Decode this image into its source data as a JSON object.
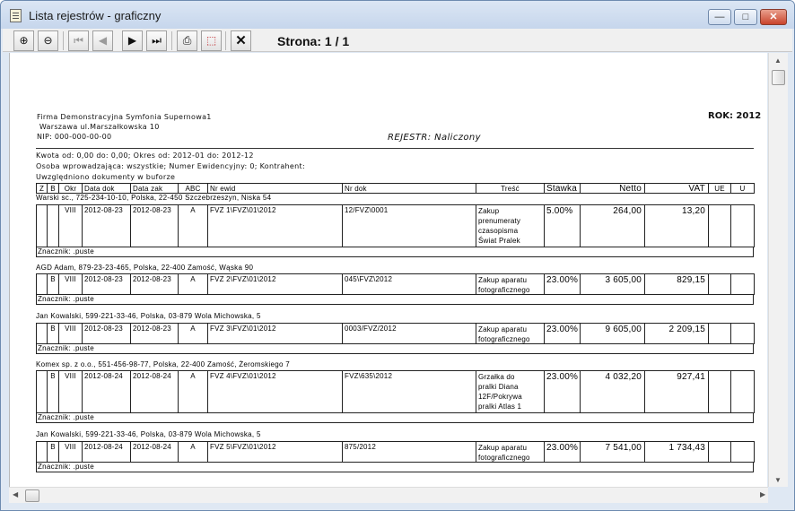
{
  "window": {
    "title": "Lista rejestrów - graficzny"
  },
  "toolbar": {
    "page_label": "Strona: 1 / 1",
    "close_symbol": "✕"
  },
  "doc": {
    "company_line1": "Firma Demonstracyjna Symfonia Supernowa1",
    "company_line2": " Warszawa ul.Marszałkowska 10",
    "company_line3": "NIP: 000-000-00-00",
    "rok": "ROK: 2012",
    "rejestr": "REJESTR: Naliczony",
    "filter_line1": "Kwota od: 0,00  do: 0,00; Okres od: 2012-01 do: 2012-12",
    "filter_line2": "Osoba wprowadzająca: wszystkie; Numer Ewidencyjny: 0; Kontrahent:",
    "filter_line3": "Uwzględniono dokumenty w buforze",
    "headers": {
      "z": "Z",
      "b": "B",
      "okr": "Okr",
      "data_dok": "Data dok",
      "data_zak": "Data zak",
      "abc": "ABC",
      "nr_ewid": "Nr ewid",
      "nr_dok": "Nr dok",
      "tresc": "Treść",
      "stawka": "Stawka",
      "netto": "Netto",
      "vat": "VAT",
      "ue": "UE",
      "u": "U"
    },
    "entries": [
      {
        "party": "Warski sc., 725-234-10-10, Polska, 22-450 Szczebrzeszyn, Niska 54",
        "z": "",
        "b": "",
        "okr": "VIII",
        "data_dok": "2012-08-23",
        "data_zak": "2012-08-23",
        "abc": "A",
        "nr_ewid": "FVZ  1\\FVZ\\01\\2012",
        "nr_dok": "12/FVZ\\0001",
        "tresc": "Zakup\nprenumeraty\nczasopisma\nŚwiat Pralek",
        "stawka": "5.00%",
        "netto": "264,00",
        "vat": "13,20",
        "marker": "Znacznik: .puste"
      },
      {
        "party": "AGD Adam, 879-23-23-465, Polska, 22-400 Zamość, Wąska 90",
        "z": "",
        "b": "B",
        "okr": "VIII",
        "data_dok": "2012-08-23",
        "data_zak": "2012-08-23",
        "abc": "A",
        "nr_ewid": "FVZ  2\\FVZ\\01\\2012",
        "nr_dok": "045\\FVZ\\2012",
        "tresc": "Zakup aparatu\nfotograficznego",
        "stawka": "23.00%",
        "netto": "3 605,00",
        "vat": "829,15",
        "marker": "Znacznik: .puste"
      },
      {
        "party": "Jan Kowalski, 599-221-33-46, Polska, 03-879 Wola Michowska,  5",
        "z": "",
        "b": "B",
        "okr": "VIII",
        "data_dok": "2012-08-23",
        "data_zak": "2012-08-23",
        "abc": "A",
        "nr_ewid": "FVZ  3\\FVZ\\01\\2012",
        "nr_dok": "0003/FVZ/2012",
        "tresc": "Zakup aparatu\nfotograficznego",
        "stawka": "23.00%",
        "netto": "9 605,00",
        "vat": "2 209,15",
        "marker": "Znacznik: .puste"
      },
      {
        "party": "Komex sp. z o.o., 551-456-98-77, Polska, 22-400 Zamość, Żeromskiego 7",
        "z": "",
        "b": "B",
        "okr": "VIII",
        "data_dok": "2012-08-24",
        "data_zak": "2012-08-24",
        "abc": "A",
        "nr_ewid": "FVZ  4\\FVZ\\01\\2012",
        "nr_dok": "FVZ\\635\\2012",
        "tresc": "Grzałka do\npralki Diana\n12F/Pokrywa\npralki Atlas 1",
        "stawka": "23.00%",
        "netto": "4 032,20",
        "vat": "927,41",
        "marker": "Znacznik: .puste"
      },
      {
        "party": "Jan Kowalski, 599-221-33-46, Polska, 03-879 Wola Michowska,  5",
        "z": "",
        "b": "B",
        "okr": "VIII",
        "data_dok": "2012-08-24",
        "data_zak": "2012-08-24",
        "abc": "A",
        "nr_ewid": "FVZ  5\\FVZ\\01\\2012",
        "nr_dok": "875/2012",
        "tresc": "Zakup aparatu\nfotograficznego",
        "stawka": "23.00%",
        "netto": "7 541,00",
        "vat": "1 734,43",
        "marker": "Znacznik: .puste"
      }
    ]
  }
}
